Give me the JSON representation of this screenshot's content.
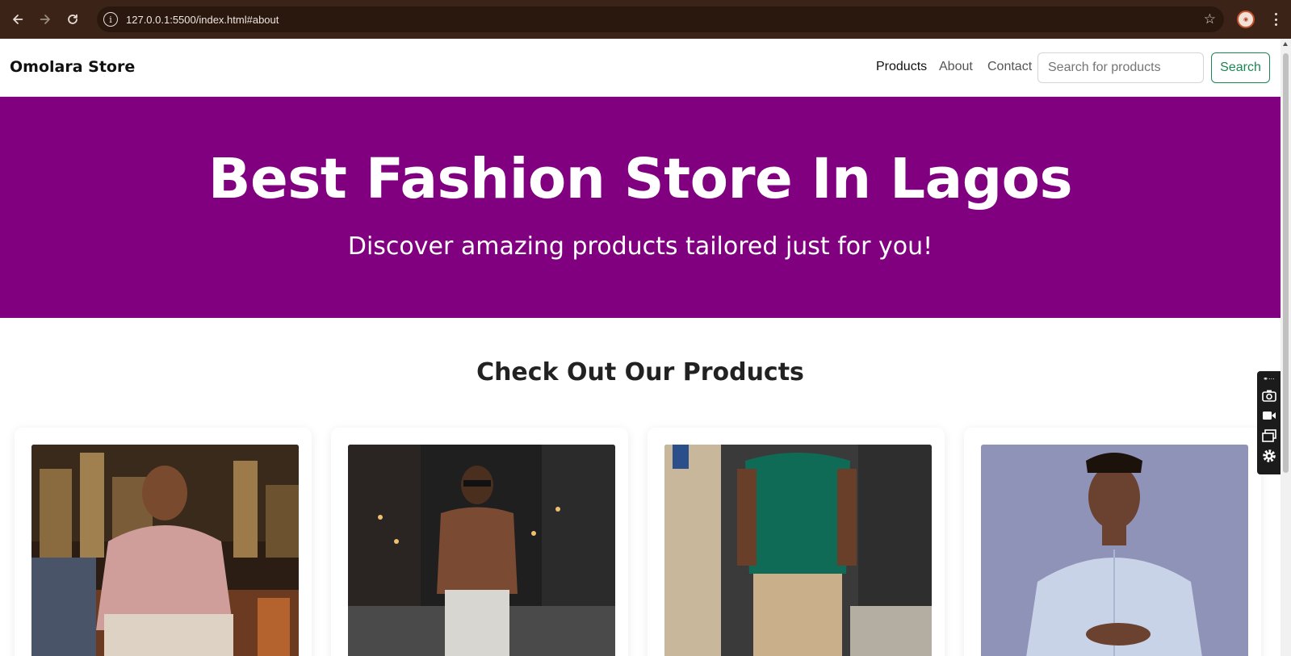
{
  "browser": {
    "url": "127.0.0.1:5500/index.html#about",
    "icons": [
      "back-arrow-icon",
      "forward-arrow-icon",
      "reload-icon",
      "site-info-icon",
      "bookmark-star-icon",
      "profile-avatar",
      "browser-menu-icon"
    ]
  },
  "navbar": {
    "brand": "Omolara Store",
    "links": [
      {
        "label": "Products",
        "active": true
      },
      {
        "label": "About",
        "active": false
      },
      {
        "label": "Contact",
        "active": false
      }
    ],
    "search": {
      "placeholder": "Search for products",
      "value": "",
      "button_label": "Search"
    }
  },
  "hero": {
    "title": "Best Fashion Store In Lagos",
    "subtitle": "Discover amazing products tailored just for you!",
    "background": "#800080"
  },
  "products": {
    "section_title": "Check Out Our Products",
    "items": [
      {
        "image": "man-in-pink-sweater-on-talk-show"
      },
      {
        "image": "man-in-brown-polo-with-sunglasses"
      },
      {
        "image": "man-in-green-tshirt-walking"
      },
      {
        "image": "man-in-light-blue-striped-shirt"
      }
    ]
  },
  "colors": {
    "chrome": "#3b2417",
    "accent_green": "#198754",
    "hero_purple": "#800080"
  }
}
